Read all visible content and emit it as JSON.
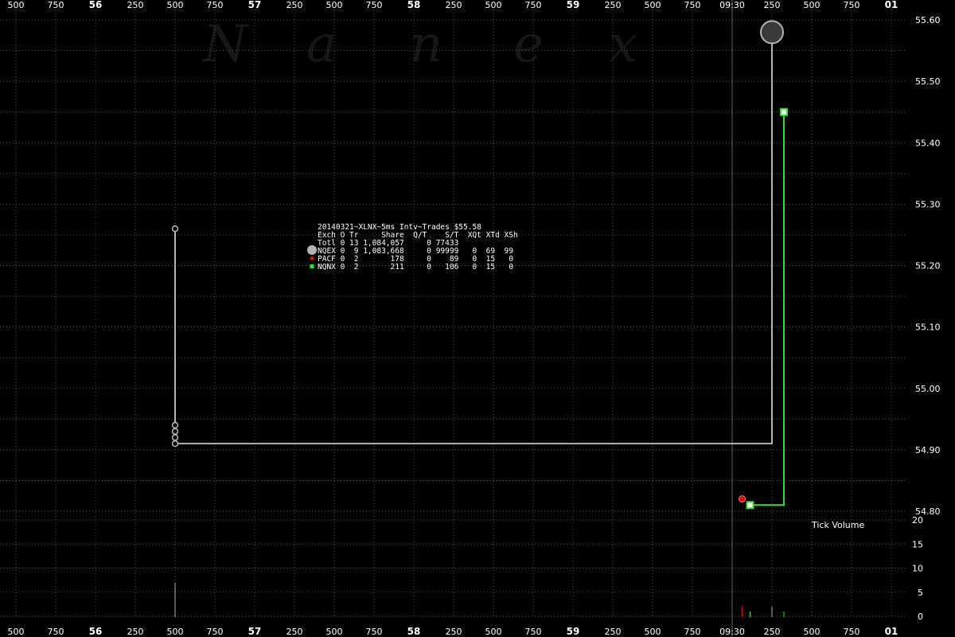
{
  "chart_data": {
    "type": "scatter",
    "title": "20140321~XLNX~5ms Intv~Trades $55.58",
    "watermark": [
      "N",
      "a",
      "n",
      "e",
      "x"
    ],
    "colors": {
      "background": "#000000",
      "grid": "#555555",
      "nqex": "#b4b4b4",
      "pacf": "#cc1111",
      "nqnx": "#33dd33",
      "vline": "#666666"
    },
    "x_ticks": [
      "500",
      "750",
      "56",
      "250",
      "500",
      "750",
      "57",
      "250",
      "500",
      "750",
      "58",
      "250",
      "500",
      "750",
      "59",
      "250",
      "500",
      "750",
      "09:30",
      "250",
      "500",
      "750",
      "01"
    ],
    "x_major_ticks": [
      "56",
      "57",
      "58",
      "59",
      "01"
    ],
    "marker_tick": "09:30",
    "price_axis": {
      "min": 54.75,
      "max": 55.62,
      "labels": [
        "55.60",
        "55.50",
        "55.40",
        "55.30",
        "55.20",
        "55.10",
        "55.00",
        "54.90",
        "54.80"
      ]
    },
    "volume_axis": {
      "title": "Tick Volume",
      "min": 0,
      "max": 20,
      "labels": [
        "20",
        "15",
        "10",
        "5",
        "0"
      ]
    },
    "legend": {
      "header": "Exch O Tr     Share  Q/T    S/T  XQt XTd XSh",
      "total": "Totl 0 13 1,084,057     0 77433",
      "rows": [
        {
          "key": "nqex",
          "text": "NQEX 0  9 1,083,668     0 99999   0  69  99"
        },
        {
          "key": "pacf",
          "text": "PACF 0  2       178     0    89   0  15   0"
        },
        {
          "key": "nqnx",
          "text": "NQNX 0  2       211     0   106   0  15   0"
        }
      ]
    },
    "series": [
      {
        "name": "NQEX",
        "color": "#b4b4b4",
        "points": [
          {
            "x": 4,
            "y": 55.26
          },
          {
            "x": 4,
            "y": 54.94
          },
          {
            "x": 4,
            "y": 54.93
          },
          {
            "x": 4,
            "y": 54.92
          },
          {
            "x": 4,
            "y": 54.91
          },
          {
            "x": 19,
            "y": 55.58
          }
        ],
        "path": [
          {
            "x": 4,
            "y": 55.26
          },
          {
            "x": 4,
            "y": 54.91
          },
          {
            "x": 19,
            "y": 54.91
          },
          {
            "x": 19,
            "y": 55.58
          }
        ]
      },
      {
        "name": "PACF",
        "color": "#cc1111",
        "points": [
          {
            "x": 18.25,
            "y": 54.82
          }
        ]
      },
      {
        "name": "NQNX",
        "color": "#33dd33",
        "points": [
          {
            "x": 18.45,
            "y": 54.81
          },
          {
            "x": 19.3,
            "y": 55.45
          }
        ],
        "path": [
          {
            "x": 18.45,
            "y": 54.81
          },
          {
            "x": 19.3,
            "y": 54.81
          },
          {
            "x": 19.3,
            "y": 55.45
          }
        ]
      }
    ],
    "volume_bars": [
      {
        "x": 4,
        "v": 7,
        "series": "NQEX"
      },
      {
        "x": 18.25,
        "v": 2,
        "series": "PACF"
      },
      {
        "x": 18.45,
        "v": 1,
        "series": "NQNX"
      },
      {
        "x": 19,
        "v": 2,
        "series": "NQEX"
      },
      {
        "x": 19.3,
        "v": 1,
        "series": "NQNX"
      }
    ]
  }
}
